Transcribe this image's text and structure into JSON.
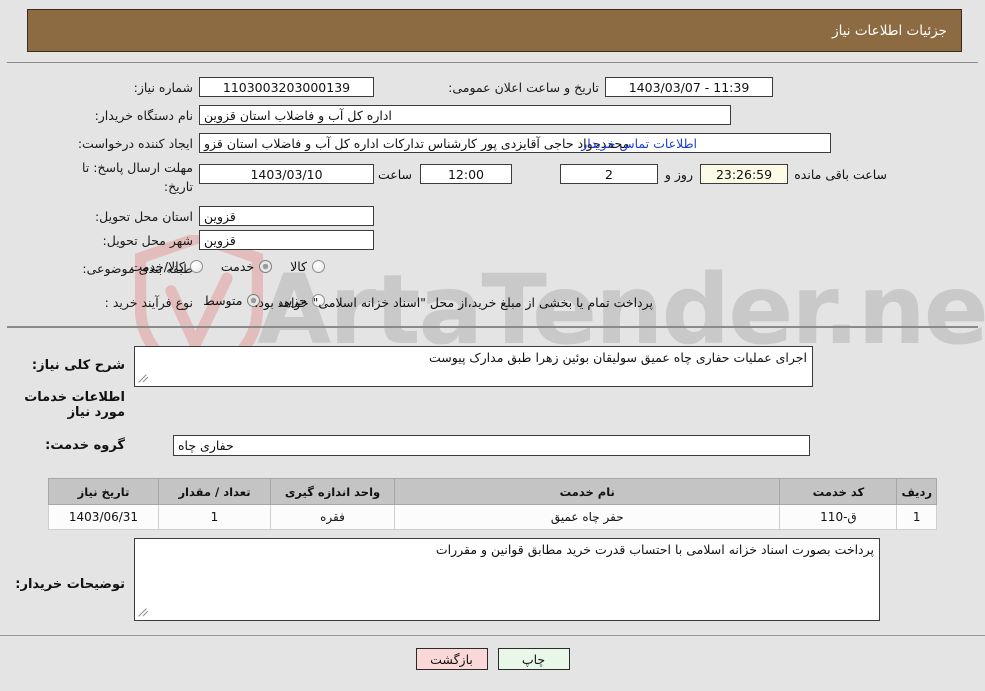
{
  "header": {
    "title": "جزئیات اطلاعات نیاز"
  },
  "fields": {
    "need_number_label": "شماره نیاز:",
    "need_number_value": "1103003203000139",
    "announce_label": "تاریخ و ساعت اعلان عمومی:",
    "announce_value": "11:39 - 1403/03/07",
    "buyer_org_label": "نام دستگاه خریدار:",
    "buyer_org_value": "اداره کل آب و فاضلاب استان قزوین",
    "requester_label": "ایجاد کننده درخواست:",
    "requester_value": "محمدجواد حاجی آقایزدی پور کارشناس تدارکات اداره کل آب و فاضلاب استان قزو",
    "buyer_contact_link": "اطلاعات تماس خریدار",
    "deadline_label": "مهلت ارسال پاسخ: تا تاریخ:",
    "deadline_date": "1403/03/10",
    "hour_label": "ساعت",
    "deadline_time": "12:00",
    "days_value": "2",
    "days_label": "روز و",
    "countdown_value": "23:26:59",
    "countdown_label": "ساعت باقی مانده",
    "province_label": "استان محل تحویل:",
    "province_value": "قزوین",
    "city_label": "شهر محل تحویل:",
    "city_value": "قزوین",
    "category_label": "طبقه بندی موضوعی:",
    "process_label": "نوع فرآیند خرید :",
    "treasury_note": "پرداخت تمام یا بخشی از مبلغ خرید،از محل \"اسناد خزانه اسلامی\" خواهد بود."
  },
  "category_options": [
    {
      "label": "کالا",
      "selected": false
    },
    {
      "label": "خدمت",
      "selected": true
    },
    {
      "label": "کالا/خدمت",
      "selected": false
    }
  ],
  "process_options": [
    {
      "label": "جزیی",
      "selected": false
    },
    {
      "label": "متوسط",
      "selected": true
    }
  ],
  "description": {
    "label": "شرح کلی نیاز:",
    "value": "اجرای عملیات حفاری چاه عمیق سولیقان  بوئین زهرا طبق مدارک پیوست"
  },
  "services_section": {
    "heading": "اطلاعات خدمات مورد نیاز",
    "group_label": "گروه خدمت:",
    "group_value": "حفاری چاه"
  },
  "table": {
    "columns": [
      "ردیف",
      "کد خدمت",
      "نام خدمت",
      "واحد اندازه گیری",
      "تعداد / مقدار",
      "تاریخ نیاز"
    ],
    "rows": [
      [
        "1",
        "ق-110",
        "حفر چاه عمیق",
        "فقره",
        "1",
        "1403/06/31"
      ]
    ]
  },
  "buyer_notes": {
    "label": "توضیحات خریدار:",
    "value": "پرداخت بصورت اسناد خزانه اسلامی با احتساب قدرت خرید مطابق قوانین و مقررات"
  },
  "buttons": {
    "print": "چاپ",
    "back": "بازگشت"
  },
  "watermark": {
    "text": "ArtaTender.net"
  },
  "colors": {
    "header_bg": "#8d6b42",
    "page_bg": "#e4e4e4",
    "link": "#1b3fd4",
    "table_header_bg": "#c4c4c4",
    "print_btn_bg": "#e9f7e9",
    "back_btn_bg": "#fad8d8",
    "countdown_bg": "#fdfbe6"
  }
}
